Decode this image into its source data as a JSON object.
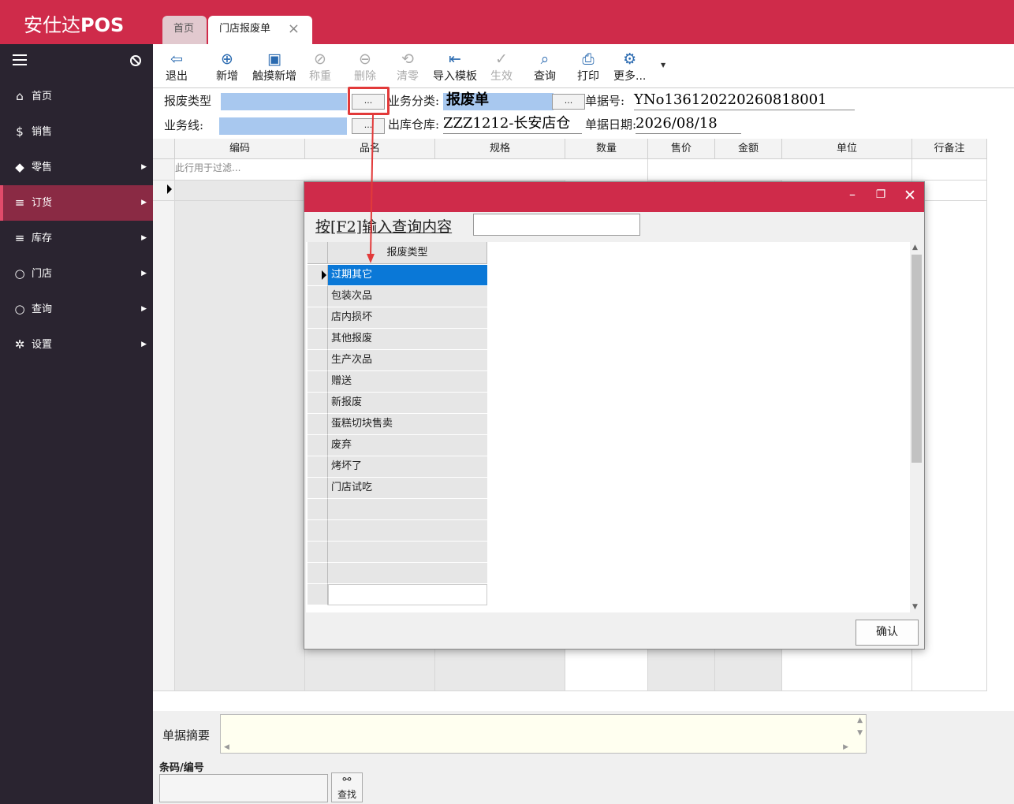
{
  "app": {
    "brand_cn": "安仕达",
    "brand_en": "POS"
  },
  "tabs": [
    {
      "label": "首页"
    },
    {
      "label": "门店报废单"
    }
  ],
  "sidebar": {
    "items": [
      {
        "label": "首页"
      },
      {
        "label": "销售"
      },
      {
        "label": "零售"
      },
      {
        "label": "订货"
      },
      {
        "label": "库存"
      },
      {
        "label": "门店"
      },
      {
        "label": "查询"
      },
      {
        "label": "设置"
      }
    ]
  },
  "toolbar": {
    "buttons": [
      {
        "label": "退出"
      },
      {
        "label": "新增"
      },
      {
        "label": "触摸新增"
      },
      {
        "label": "称重"
      },
      {
        "label": "删除"
      },
      {
        "label": "清零"
      },
      {
        "label": "导入模板"
      },
      {
        "label": "生效"
      },
      {
        "label": "查询"
      },
      {
        "label": "打印"
      },
      {
        "label": "更多..."
      }
    ]
  },
  "form": {
    "scrap_type_label": "报废类型",
    "business_category_label": "业务分类:",
    "business_category_value": "报废单",
    "doc_no_label": "单据号:",
    "doc_no_value": "YNo136120220260818001",
    "business_line_label": "业务线:",
    "warehouse_label": "出库仓库:",
    "warehouse_value": "ZZZ1212-长安店仓",
    "doc_date_label": "单据日期:",
    "doc_date_value": "2026/08/18",
    "ellipsis": "..."
  },
  "grid": {
    "columns": [
      "编码",
      "品名",
      "规格",
      "数量",
      "售价",
      "金额",
      "单位",
      "行备注"
    ],
    "filter_placeholder": "此行用于过滤..."
  },
  "summary": {
    "label": "单据摘要"
  },
  "barcode": {
    "label": "条码/编号",
    "find_label": "查找"
  },
  "modal": {
    "search_label": "按[F2]输入查询内容",
    "column": "报废类型",
    "rows": [
      "过期其它",
      "包装次品",
      "店内损坏",
      "其他报废",
      "生产次品",
      "赠送",
      "新报废",
      "蛋糕切块售卖",
      "废弃",
      "烤坏了",
      "门店试吃"
    ],
    "confirm_label": "确认"
  },
  "colors": {
    "brand": "#cf2b4a",
    "sidebar": "#2a2430",
    "sidebar_active": "#8a2a44",
    "selection": "#0a78d7",
    "field": "#a8c8ef"
  }
}
